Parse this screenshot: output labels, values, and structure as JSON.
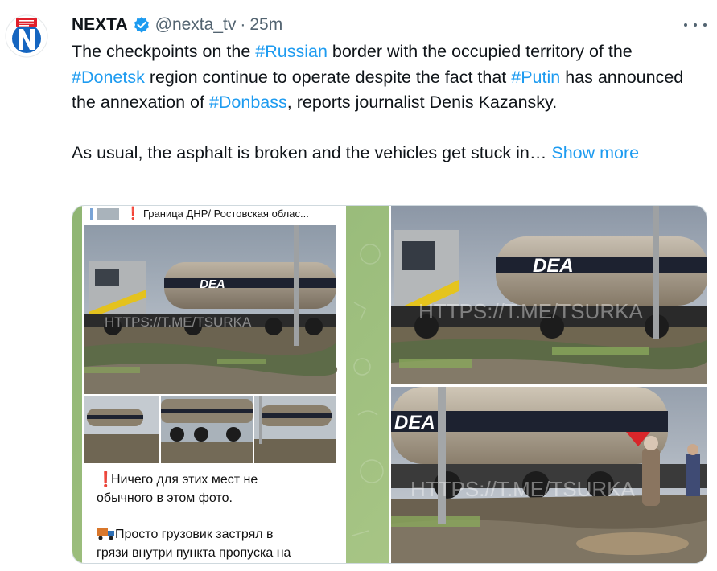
{
  "tweet": {
    "author_name": "NEXTA",
    "handle": "@nexta_tv",
    "separator": "·",
    "time": "25m",
    "text_para1": [
      {
        "t": "The checkpoints on the ",
        "tag": false
      },
      {
        "t": "#Russian",
        "tag": true
      },
      {
        "t": " border with the occupied territory of the ",
        "tag": false
      },
      {
        "t": "#Donetsk",
        "tag": true
      },
      {
        "t": " region continue to operate despite the fact that ",
        "tag": false
      },
      {
        "t": "#Putin",
        "tag": true
      },
      {
        "t": " has announced the annexation of ",
        "tag": false
      },
      {
        "t": "#Donbass",
        "tag": true
      },
      {
        "t": ", reports journalist Denis Kazansky.",
        "tag": false
      }
    ],
    "text_para2": "As usual, the asphalt is broken and the vehicles get stuck in…",
    "show_more": "Show more"
  },
  "media": {
    "screenshot_header": "Граница ДНР/ Ростовская облас...",
    "screenshot_caption_1": "Ничего для этих мест не обычного в этом фото.",
    "screenshot_caption_2": "Просто грузовик застрял в грязи внутри пункта пропуска на",
    "tanker_brand": "DEA",
    "watermark": "HTTPS://T.ME/TSURKA",
    "photo_alts": [
      "screenshot-photo",
      "tanker-photo-top",
      "tanker-photo-bottom"
    ]
  },
  "icons": {
    "avatar": "nexta-logo-icon",
    "verified": "verified-badge-icon",
    "more": "more-options-icon"
  },
  "colors": {
    "link": "#1d9bf0",
    "nexta_red": "#e0202b",
    "nexta_blue": "#1565c0",
    "text": "#0f1419",
    "secondary": "#536471"
  }
}
